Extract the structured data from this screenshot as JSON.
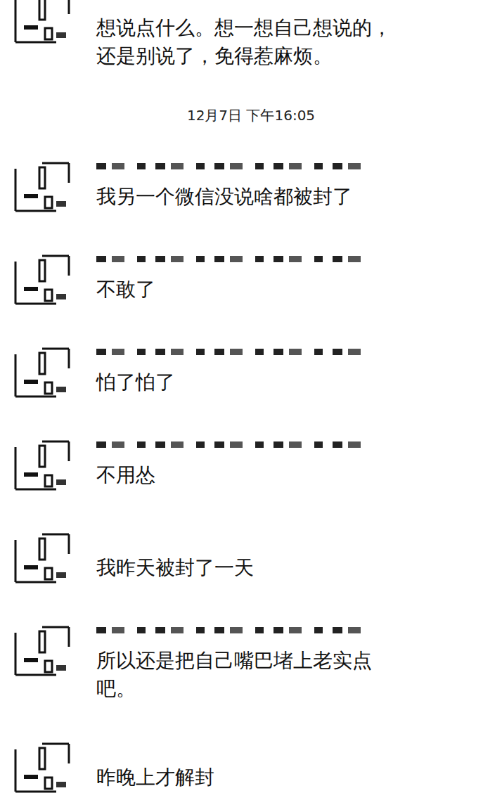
{
  "messages_before": [
    {
      "text": "想说点什么。想一想自己想说的，还是别说了，免得惹麻烦。",
      "name_redacted": false,
      "cut_off_top": true
    }
  ],
  "timestamp": "12月7日 下午16:05",
  "messages": [
    {
      "text": "我另一个微信没说啥都被封了",
      "name_redacted": true,
      "cut_off_top": false
    },
    {
      "text": "不敢了",
      "name_redacted": true,
      "cut_off_top": false
    },
    {
      "text": "怕了怕了",
      "name_redacted": true,
      "cut_off_top": false
    },
    {
      "text": "不用怂",
      "name_redacted": true,
      "cut_off_top": false
    },
    {
      "text": "我昨天被封了一天",
      "name_redacted": false,
      "cut_off_top": false
    },
    {
      "text": "所以还是把自己嘴巴堵上老实点吧。",
      "name_redacted": true,
      "cut_off_top": false
    },
    {
      "text": "昨晚上才解封",
      "name_redacted": false,
      "cut_off_top": false
    }
  ]
}
